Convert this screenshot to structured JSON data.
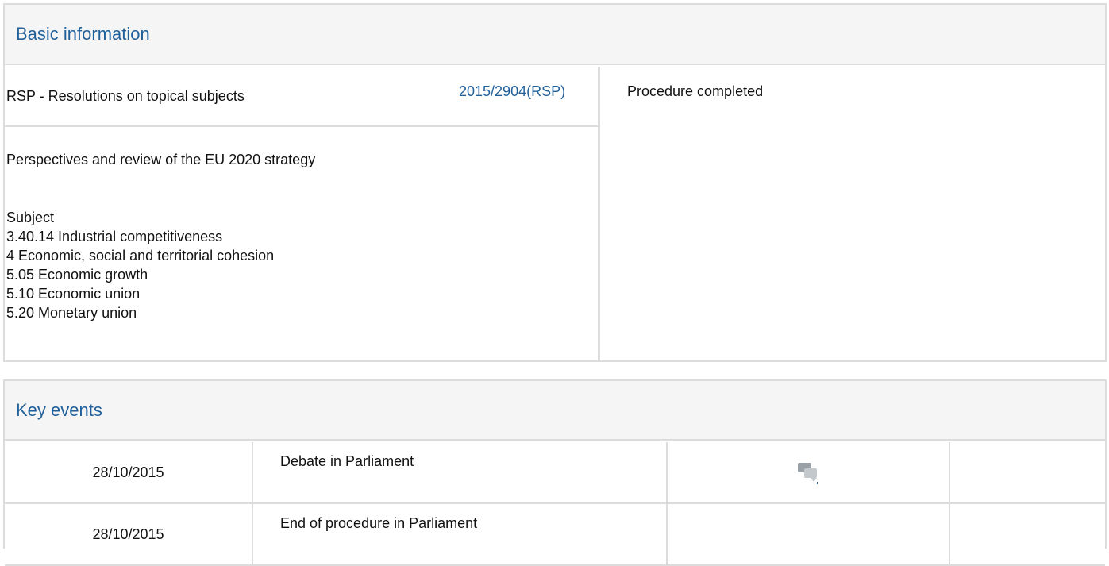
{
  "basic": {
    "title": "Basic information",
    "procedure_type": "RSP - Resolutions on topical subjects",
    "procedure_ref": "2015/2904(RSP)",
    "procedure_title": "Perspectives and review of the EU 2020 strategy",
    "subject_label": "Subject",
    "subjects": [
      "3.40.14 Industrial competitiveness",
      "4 Economic, social and territorial cohesion",
      "5.05 Economic growth",
      "5.10 Economic union",
      "5.20 Monetary union"
    ],
    "status": "Procedure completed"
  },
  "events": {
    "title": "Key events",
    "rows": [
      {
        "date": "28/10/2015",
        "event": "Debate in Parliament",
        "icon": "debate-icon"
      },
      {
        "date": "28/10/2015",
        "event": "End of procedure in Parliament",
        "icon": ""
      }
    ]
  },
  "colors": {
    "accent": "#1f5f9a",
    "border": "#dcdcdc",
    "header_bg": "#f5f5f5"
  }
}
